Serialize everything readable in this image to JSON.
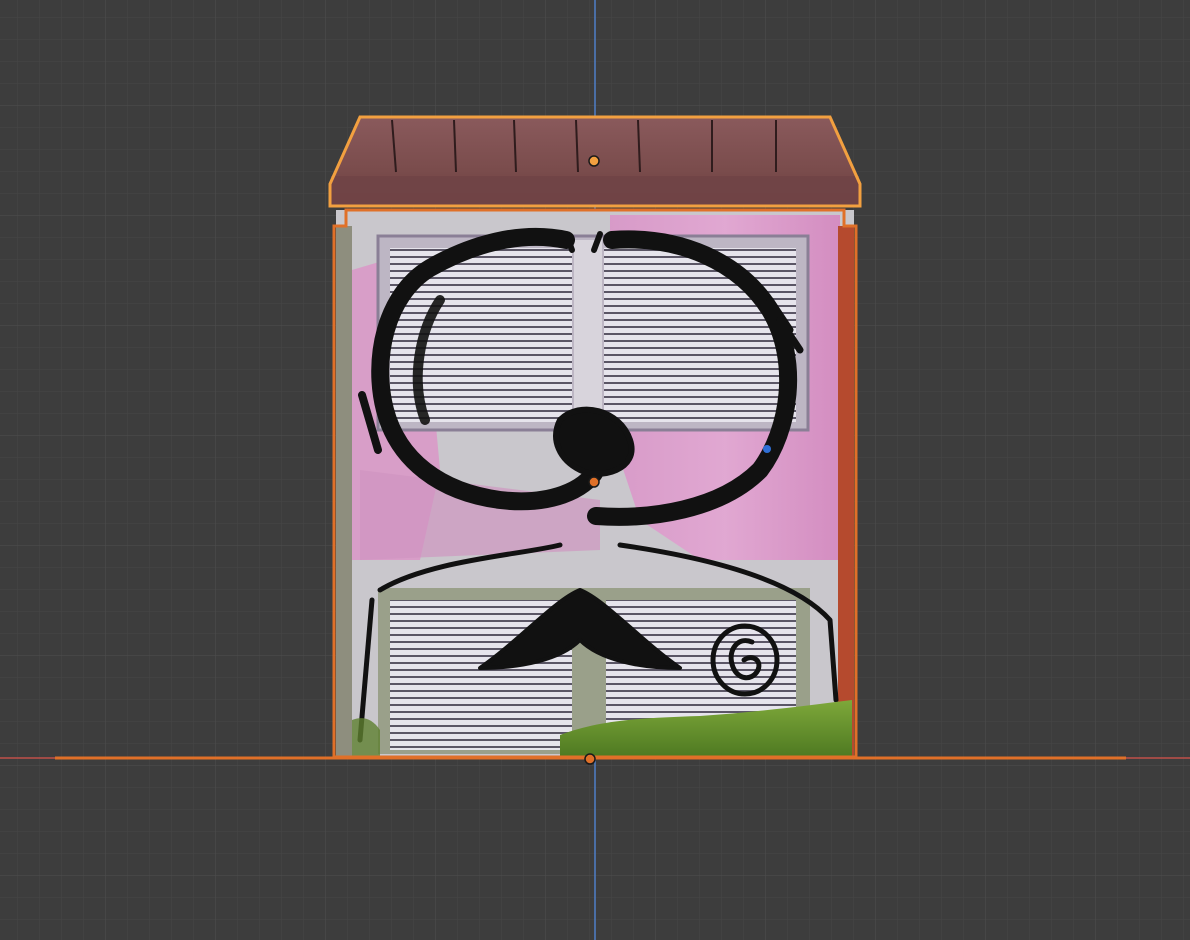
{
  "viewport": {
    "view": "front-orthographic",
    "grid": true,
    "grid_color": "#474747",
    "grid_major_color": "#4d4d4d",
    "background_color": "#3d3d3d",
    "axis_x_color": "#c0504a",
    "axis_z_color": "#4f7fc8"
  },
  "scene_objects": [
    {
      "name": "roof",
      "selected": true,
      "active": false,
      "outline_color": "#f2a040",
      "texture": "brown-corrugated-roof",
      "origin_icon": "origin-dot"
    },
    {
      "name": "body",
      "selected": true,
      "active": true,
      "outline_color": "#e07028",
      "texture": "graffiti-wall-with-louvered-vents",
      "origin_icon": "origin-dot"
    },
    {
      "name": "ground-plane",
      "selected": true,
      "active": false,
      "outline_color": "#e07028",
      "texture": "none",
      "origin_icon": "origin-dot"
    }
  ],
  "light_gizmo": {
    "color": "#2f6fd6",
    "icon": "light-dot"
  }
}
